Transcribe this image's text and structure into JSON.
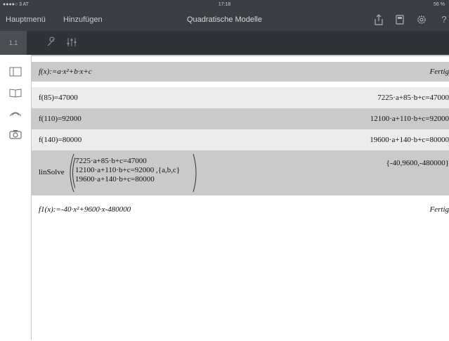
{
  "status": {
    "carrier": "●●●●○ 3 AT",
    "time": "17:18",
    "battery": "56 %"
  },
  "nav": {
    "menu_label": "Hauptmenü",
    "add_label": "Hinzufügen",
    "title": "Quadratische Modelle"
  },
  "toolbar": {
    "page_label": "1.1"
  },
  "calc": {
    "row1_lhs": "f(x):=a·x²+b·x+c",
    "row1_rhs": "Fertig",
    "row2_lhs": "f(85)=47000",
    "row2_rhs": "7225·a+85·b+c=47000",
    "row3_lhs": "f(110)=92000",
    "row3_rhs": "12100·a+110·b+c=92000",
    "row4_lhs": "f(140)=80000",
    "row4_rhs": "19600·a+140·b+c=80000",
    "linsolve_label": "linSolve",
    "eq1": "7225·a+85·b+c=47000",
    "eq2": "12100·a+110·b+c=92000 ,{a,b,c}",
    "eq3": "19600·a+140·b+c=80000",
    "linsolve_result": "{-40,9600,-480000}",
    "row6_lhs": "f1(x):=-40·x²+9600·x-480000",
    "row6_rhs": "Fertig"
  }
}
